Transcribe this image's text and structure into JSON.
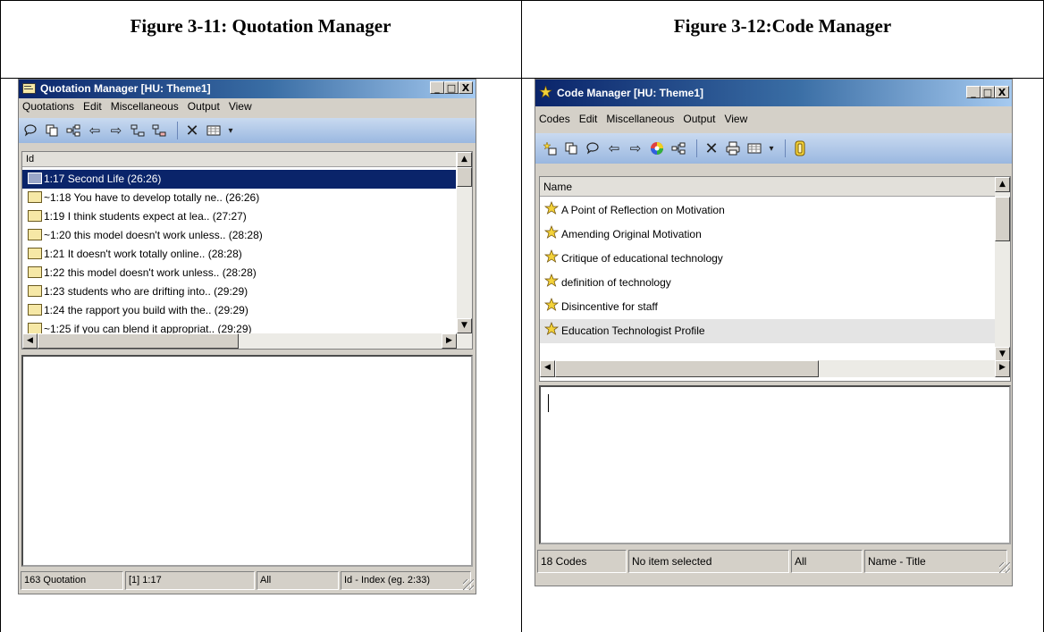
{
  "captions": {
    "left": "Figure 3-11: Quotation Manager",
    "right": "Figure 3-12:Code Manager"
  },
  "quotation_manager": {
    "title": "Quotation Manager [HU: Theme1]",
    "window_controls": {
      "minimize": "_",
      "maximize": "□",
      "close": "X"
    },
    "menu": [
      "Quotations",
      "Edit",
      "Miscellaneous",
      "Output",
      "View"
    ],
    "toolbar_icons": [
      "comment-icon",
      "copy-icon",
      "network-icon",
      "arrow-left-icon",
      "arrow-right-icon",
      "tree-icon",
      "tree-collapse-icon",
      "delete-icon",
      "list-view-icon"
    ],
    "column_header": "Id",
    "rows": [
      {
        "text": "1:17 Second Life (26:26)",
        "selected": true,
        "icon": "quotation-icon"
      },
      {
        "text": "~1:18 You have to develop totally ne.. (26:26)",
        "selected": false,
        "icon": "linked-quotation-icon"
      },
      {
        "text": "1:19 I think students expect at lea.. (27:27)",
        "selected": false,
        "icon": "quotation-icon"
      },
      {
        "text": "~1:20 this model doesn't work unless.. (28:28)",
        "selected": false,
        "icon": "linked-quotation-icon"
      },
      {
        "text": "1:21 It doesn't work totally online.. (28:28)",
        "selected": false,
        "icon": "quotation-icon"
      },
      {
        "text": "1:22 this model doesn't work unless.. (28:28)",
        "selected": false,
        "icon": "quotation-icon"
      },
      {
        "text": "1:23 students who are drifting into.. (29:29)",
        "selected": false,
        "icon": "quotation-icon"
      },
      {
        "text": "1:24 the rapport you build with the.. (29:29)",
        "selected": false,
        "icon": "quotation-icon"
      },
      {
        "text": "~1:25 if you can blend it appropriat.. (29:29)",
        "selected": false,
        "icon": "linked-quotation-icon"
      }
    ],
    "status": {
      "count": "163 Quotation",
      "current": "[1] 1:17",
      "filter": "All",
      "sort": "Id - Index (eg. 2:33)"
    }
  },
  "code_manager": {
    "title": "Code Manager [HU: Theme1]",
    "window_controls": {
      "minimize": "_",
      "maximize": "□",
      "close": "X"
    },
    "menu": [
      "Codes",
      "Edit",
      "Miscellaneous",
      "Output",
      "View"
    ],
    "toolbar_icons": [
      "new-code-icon",
      "copy-icon",
      "comment-icon",
      "arrow-left-icon",
      "arrow-right-icon",
      "color-wheel-icon",
      "network-icon",
      "delete-icon",
      "print-icon",
      "list-view-icon",
      "filter-icon"
    ],
    "column_header": "Name",
    "rows": [
      {
        "text": "A Point of Reflection on Motivation",
        "highlighted": false
      },
      {
        "text": "Amending Original Motivation",
        "highlighted": false
      },
      {
        "text": "Critique of educational technology",
        "highlighted": false
      },
      {
        "text": "definition of technology",
        "highlighted": false
      },
      {
        "text": "Disincentive for staff",
        "highlighted": false
      },
      {
        "text": "Education Technologist Profile",
        "highlighted": true
      }
    ],
    "status": {
      "count": "18 Codes",
      "selection": "No item selected",
      "filter": "All",
      "sort": "Name - Title"
    }
  },
  "colors": {
    "selection": "#0a246a",
    "toolbar": "#9ab8e0",
    "window_face": "#d4d0c8"
  }
}
